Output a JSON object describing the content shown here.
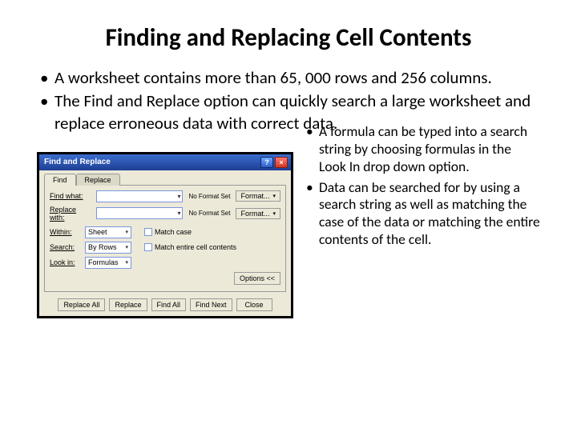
{
  "title": "Finding and Replacing Cell Contents",
  "bullets_top": [
    "A worksheet contains more than 65, 000 rows and 256 columns.",
    "The Find and Replace option can quickly search a large worksheet and replace erroneous data with correct data."
  ],
  "bullets_side": [
    "A formula can be typed into a search string by choosing formulas in the Look In drop down option.",
    "Data can be searched for by using a search string as well as matching the case of the data or matching the entire contents of the cell."
  ],
  "dialog": {
    "title": "Find and Replace",
    "help": "?",
    "close": "×",
    "tab_find": "Find",
    "tab_replace": "Replace",
    "find_what": "Find what:",
    "replace_with": "Replace with:",
    "no_format": "No Format Set",
    "format_btn": "Format...",
    "within_lbl": "Within:",
    "within_val": "Sheet",
    "search_lbl": "Search:",
    "search_val": "By Rows",
    "lookin_lbl": "Look in:",
    "lookin_val": "Formulas",
    "match_case": "Match case",
    "match_entire": "Match entire cell contents",
    "options_btn": "Options <<",
    "replace_all": "Replace All",
    "replace": "Replace",
    "find_all": "Find All",
    "find_next": "Find Next",
    "close_btn": "Close"
  }
}
